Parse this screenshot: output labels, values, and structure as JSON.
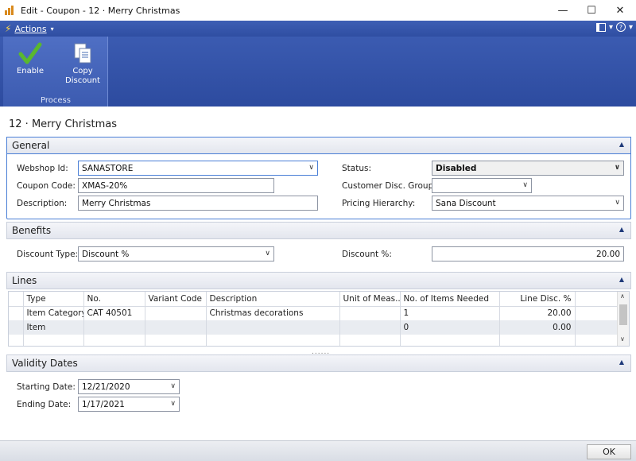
{
  "window": {
    "title": "Edit - Coupon - 12 · Merry Christmas",
    "minimize": "—",
    "maximize": "☐",
    "close": "✕"
  },
  "actions_bar": {
    "label": "Actions",
    "caret": "▾",
    "layout_caret": "▾",
    "help_glyph": "?",
    "help_caret": "▾"
  },
  "ribbon": {
    "group_label": "Process",
    "buttons": [
      {
        "label": "Enable",
        "icon": "checkmark-icon"
      },
      {
        "label": "Copy Discount",
        "icon": "copy-documents-icon"
      }
    ]
  },
  "page_title": "12 · Merry Christmas",
  "general": {
    "header": "General",
    "webshop_id": {
      "label": "Webshop Id:",
      "value": "SANASTORE"
    },
    "coupon_code": {
      "label": "Coupon Code:",
      "value": "XMAS-20%"
    },
    "description": {
      "label": "Description:",
      "value": "Merry Christmas"
    },
    "status": {
      "label": "Status:",
      "value": "Disabled"
    },
    "customer_disc_group": {
      "label": "Customer Disc. Group:",
      "value": ""
    },
    "pricing_hierarchy": {
      "label": "Pricing Hierarchy:",
      "value": "Sana Discount"
    }
  },
  "benefits": {
    "header": "Benefits",
    "discount_type": {
      "label": "Discount Type:",
      "value": "Discount %"
    },
    "discount_pct": {
      "label": "Discount %:",
      "value": "20.00"
    }
  },
  "lines": {
    "header": "Lines",
    "columns": [
      "Type",
      "No.",
      "Variant Code",
      "Description",
      "Unit of Meas...",
      "No. of Items Needed",
      "Line Disc. %"
    ],
    "rows": [
      [
        "Item Category",
        "CAT 40501",
        "",
        "Christmas decorations",
        "",
        "1",
        "20.00"
      ],
      [
        "Item",
        "",
        "",
        "",
        "",
        "0",
        "0.00"
      ],
      [
        "",
        "",
        "",
        "",
        "",
        "",
        ""
      ]
    ],
    "grip": "......"
  },
  "validity": {
    "header": "Validity Dates",
    "starting_date": {
      "label": "Starting Date:",
      "value": "12/21/2020"
    },
    "ending_date": {
      "label": "Ending Date:",
      "value": "1/17/2021"
    }
  },
  "footer": {
    "ok_label": "OK"
  },
  "colors": {
    "ribbon": "#2f4ea2",
    "accent_border": "#4a7fd6",
    "enable_check": "#5ab82e"
  }
}
